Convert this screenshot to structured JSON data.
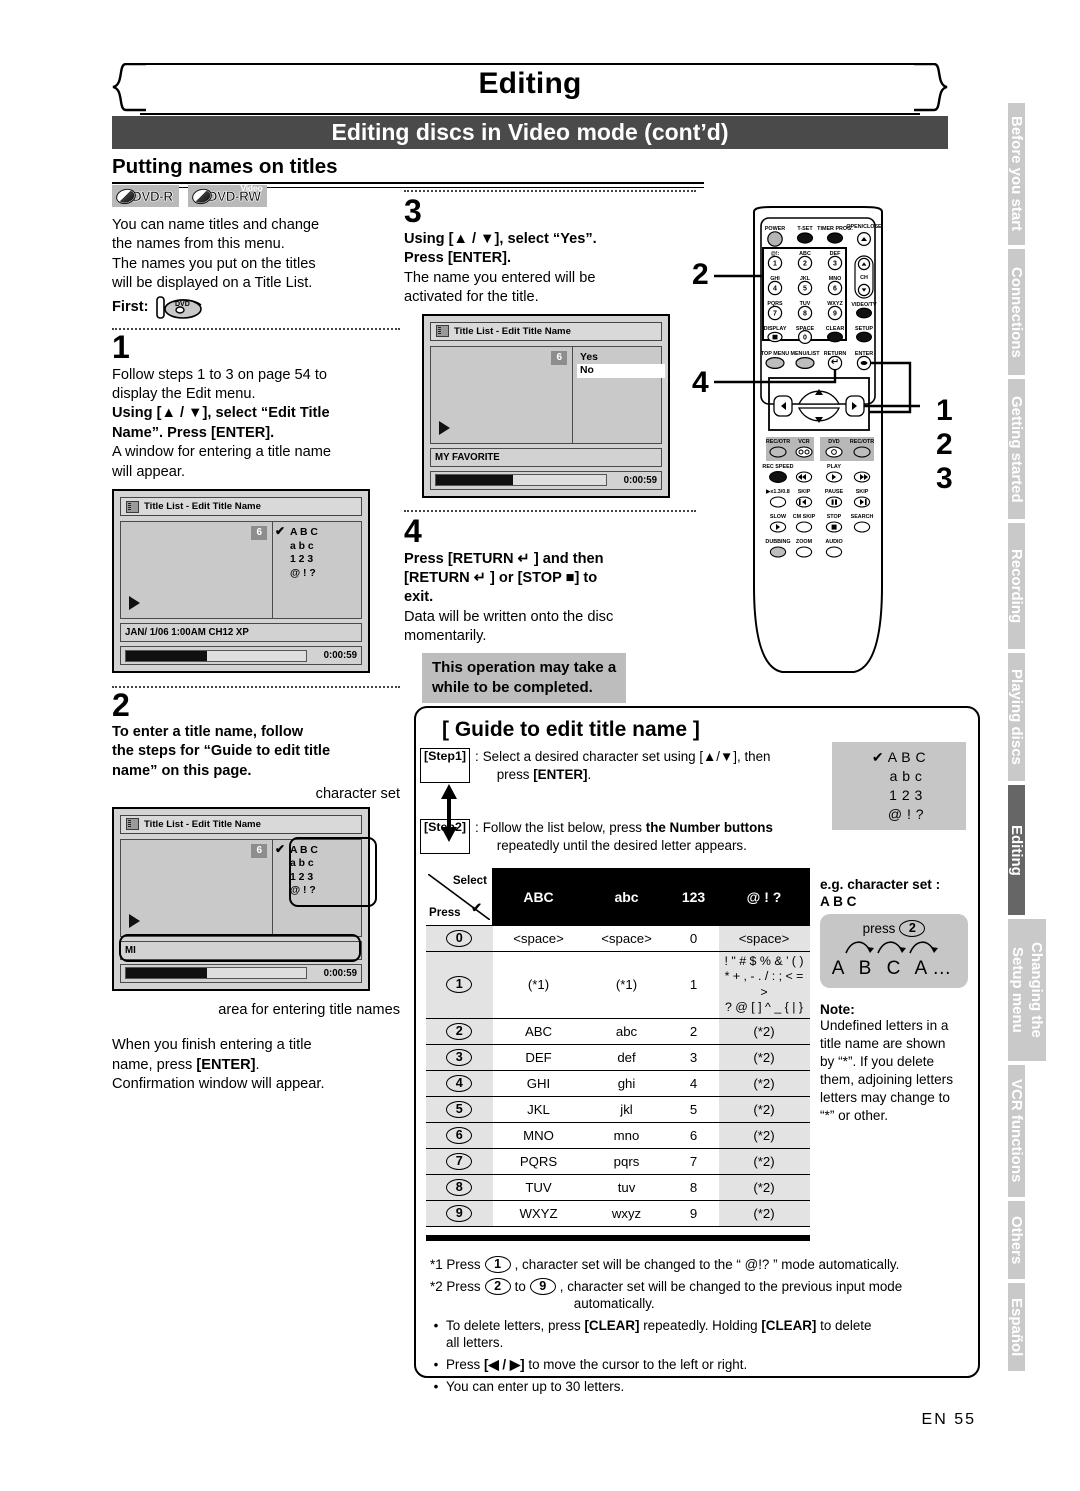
{
  "header": {
    "chapter": "Editing",
    "section": "Editing discs in Video mode (cont’d)",
    "subsection": "Putting names on titles"
  },
  "media_logos": [
    {
      "name": "DVD-R",
      "badge": ""
    },
    {
      "name": "DVD-RW",
      "badge": "Video"
    }
  ],
  "intro": {
    "line1": "You can name titles and change",
    "line2": "the names from this menu.",
    "line3": "The names you put on the titles",
    "line4": "will be displayed on a Title List.",
    "first_label": "First:",
    "first_icon": "dvd-disc-insert-icon"
  },
  "steps": {
    "s1": {
      "num": "1",
      "body1": "Follow steps 1 to 3 on page 54 to",
      "body2": "display the Edit menu.",
      "bold1": "Using [▲ / ▼], select “Edit Title",
      "bold2": "Name”. Press [ENTER].",
      "body3": "A window for entering a title name",
      "body4": "will appear."
    },
    "s2": {
      "num": "2",
      "bold1": "To enter a title name, follow",
      "bold2": "the steps for “Guide to edit title",
      "bold3": "name” on this page.",
      "callout_top": "character set",
      "callout_bottom": "area for entering title names",
      "after1": "When you finish entering a title",
      "after2_pre": "name, press ",
      "after2_bold": "[ENTER]",
      "after2_post": ".",
      "after3": "Confirmation window will appear."
    },
    "s3": {
      "num": "3",
      "bold1": "Using [▲ / ▼], select “Yes”.",
      "bold2": "Press [ENTER].",
      "body1": "The name you entered will be",
      "body2": "activated for the title."
    },
    "s4": {
      "num": "4",
      "bold1": "Press [RETURN ↵ ] and then",
      "bold2": "[RETURN ↵ ] or [STOP ■] to",
      "bold3": "exit.",
      "body1": "Data will be written onto the disc",
      "body2": "momentarily.",
      "notice1": "This operation may take a",
      "notice2": "while to be completed."
    }
  },
  "screens": {
    "s1": {
      "titlebar": "Title List - Edit Title Name",
      "badge": "6",
      "charset": [
        "A B C",
        "a b c",
        "1 2 3",
        "@ ! ?"
      ],
      "info": "JAN/ 1/06 1:00AM CH12 XP",
      "time": "0:00:59"
    },
    "s2": {
      "titlebar": "Title List - Edit Title Name",
      "badge": "6",
      "charset": [
        "A B C",
        "a b c",
        "1 2 3",
        "@ ! ?"
      ],
      "info": "MI",
      "time": "0:00:59"
    },
    "s3": {
      "titlebar": "Title List - Edit Title Name",
      "badge": "6",
      "options": [
        "Yes",
        "No"
      ],
      "info": "MY FAVORITE",
      "time": "0:00:59"
    }
  },
  "remote": {
    "labels": {
      "power": "POWER",
      "tset": "T-SET",
      "timer": "TIMER PROG.",
      "openclose": "OPEN/CLOSE",
      "k1": "@!:",
      "k2": "ABC",
      "k3": "DEF",
      "k4": "GHI",
      "k5": "JKL",
      "k6": "MNO",
      "k7": "PQRS",
      "k8": "TUV",
      "k9": "WXYZ",
      "display": "DISPLAY",
      "space": "SPACE",
      "clear": "CLEAR",
      "ch": "CH",
      "videotv": "VIDEO/TV",
      "setup": "SETUP",
      "topmenu": "TOP MENU",
      "menulist": "MENU/LIST",
      "return": "RETURN",
      "enter": "ENTER",
      "recotr_l": "REC/OTR",
      "vcr": "VCR",
      "dvd": "DVD",
      "recotr_r": "REC/OTR",
      "recspeed": "REC SPEED",
      "play": "PLAY",
      "x130": "▶x1.3/0.8",
      "skip_l": "SKIP",
      "pause": "PAUSE",
      "skip_r": "SKIP",
      "slow": "SLOW",
      "cmskip": "CM SKIP",
      "stop": "STOP",
      "search": "SEARCH",
      "dubbing": "DUBBING",
      "zoom": "ZOOM",
      "audio": "AUDIO"
    },
    "callouts": {
      "left_top": "2",
      "left_bottom": "4",
      "right": [
        "1",
        "2",
        "3"
      ]
    }
  },
  "guide": {
    "title": "[ Guide to edit title name ]",
    "step1_label": "[Step1]",
    "step1_a": "Select a desired character set using [▲/▼], then",
    "step1_b_pre": "press ",
    "step1_b_bold": "[ENTER]",
    "step1_b_post": ".",
    "step2_label": "[Step2]",
    "step2_a_pre": "Follow the list below, press ",
    "step2_a_bold": "the Number buttons",
    "step2_b": "repeatedly until the desired letter appears.",
    "charset_box": [
      "✔  A B C",
      "a b c",
      "1 2 3",
      "@ ! ?"
    ],
    "eg_title1": "e.g. character set :",
    "eg_title2": "A B C",
    "eg_press": "press",
    "eg_press_key": "2",
    "eg_seq": "A B C A…",
    "note_title": "Note:",
    "note_lines": [
      "Undefined letters in a",
      "title name are shown",
      "by “*”.  If you delete",
      "them, adjoining letters",
      "letters may change to",
      "“*” or other."
    ]
  },
  "char_table": {
    "corner": {
      "select": "Select",
      "press": "Press",
      "check": "✔"
    },
    "columns": [
      "ABC",
      "abc",
      "123",
      "@ ! ?"
    ],
    "rows": [
      {
        "key": "0",
        "abc": "<space>",
        "lower": "<space>",
        "num": "0",
        "sym": "<space>"
      },
      {
        "key": "1",
        "abc": "(*1)",
        "lower": "(*1)",
        "num": "1",
        "sym": [
          "! \" # $ % & ’ ( )",
          "* + , - . / : ; < = >",
          "? @ [ ] ^ _ { | }"
        ]
      },
      {
        "key": "2",
        "abc": "ABC",
        "lower": "abc",
        "num": "2",
        "sym": "(*2)"
      },
      {
        "key": "3",
        "abc": "DEF",
        "lower": "def",
        "num": "3",
        "sym": "(*2)"
      },
      {
        "key": "4",
        "abc": "GHI",
        "lower": "ghi",
        "num": "4",
        "sym": "(*2)"
      },
      {
        "key": "5",
        "abc": "JKL",
        "lower": "jkl",
        "num": "5",
        "sym": "(*2)"
      },
      {
        "key": "6",
        "abc": "MNO",
        "lower": "mno",
        "num": "6",
        "sym": "(*2)"
      },
      {
        "key": "7",
        "abc": "PQRS",
        "lower": "pqrs",
        "num": "7",
        "sym": "(*2)"
      },
      {
        "key": "8",
        "abc": "TUV",
        "lower": "tuv",
        "num": "8",
        "sym": "(*2)"
      },
      {
        "key": "9",
        "abc": "WXYZ",
        "lower": "wxyz",
        "num": "9",
        "sym": "(*2)"
      }
    ]
  },
  "footnotes": {
    "f1_a": "*1 Press",
    "f1_key": "1",
    "f1_b": ", character set will be changed to the “ @!? ” mode automatically.",
    "f2_a": "*2 Press",
    "f2_key1": "2",
    "f2_mid": "to",
    "f2_key2": "9",
    "f2_b": ", character set will be changed to the previous input mode",
    "f2_c": "automatically.",
    "b1_pre": "To delete letters, press ",
    "b1_k1": "[CLEAR]",
    "b1_mid": " repeatedly. Holding ",
    "b1_k2": "[CLEAR]",
    "b1_post": " to delete",
    "b1_post2": "all letters.",
    "b2_pre": "Press ",
    "b2_key": "[◀ / ▶]",
    "b2_post": " to move the cursor to the left or right.",
    "b3": "You can enter up to 30 letters."
  },
  "index_tabs": [
    {
      "label": "Before you start",
      "active": false
    },
    {
      "label": "Connections",
      "active": false
    },
    {
      "label": "Getting started",
      "active": false
    },
    {
      "label": "Recording",
      "active": false
    },
    {
      "label": "Playing discs",
      "active": false
    },
    {
      "label": "Editing",
      "active": true
    },
    {
      "label": "Changing the Setup menu",
      "active": false
    },
    {
      "label": "VCR functions",
      "active": false
    },
    {
      "label": "Others",
      "active": false
    },
    {
      "label": "Español",
      "active": false
    }
  ],
  "page_number": "EN  55"
}
